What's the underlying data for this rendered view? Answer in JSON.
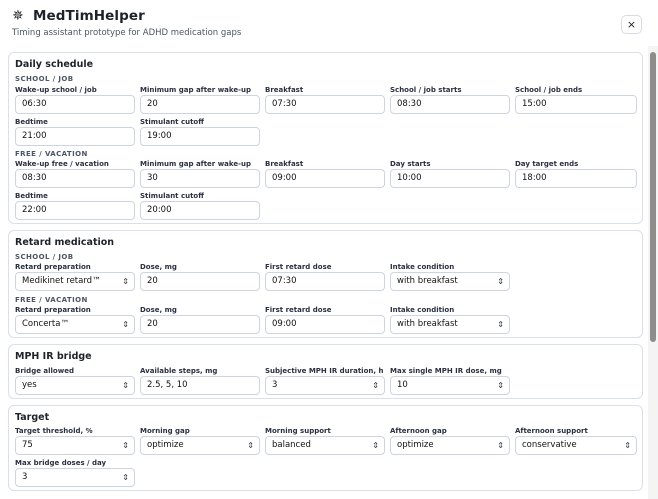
{
  "app": {
    "title": "MedTimHelper",
    "subtitle": "Timing assistant prototype for ADHD medication gaps",
    "close": "×"
  },
  "daily": {
    "title": "Daily schedule",
    "school": {
      "group": "SCHOOL / JOB",
      "wakeup_label": "Wake-up school / job",
      "wakeup": "06:30",
      "mingap_label": "Minimum gap after wake-up",
      "mingap": "20",
      "breakfast_label": "Breakfast",
      "breakfast": "07:30",
      "starts_label": "School / job starts",
      "starts": "08:30",
      "ends_label": "School / job ends",
      "ends": "15:00",
      "bedtime_label": "Bedtime",
      "bedtime": "21:00",
      "cutoff_label": "Stimulant cutoff",
      "cutoff": "19:00"
    },
    "free": {
      "group": "FREE / VACATION",
      "wakeup_label": "Wake-up free / vacation",
      "wakeup": "08:30",
      "mingap_label": "Minimum gap after wake-up",
      "mingap": "30",
      "breakfast_label": "Breakfast",
      "breakfast": "09:00",
      "starts_label": "Day starts",
      "starts": "10:00",
      "ends_label": "Day target ends",
      "ends": "18:00",
      "bedtime_label": "Bedtime",
      "bedtime": "22:00",
      "cutoff_label": "Stimulant cutoff",
      "cutoff": "20:00"
    }
  },
  "retard": {
    "title": "Retard medication",
    "school": {
      "group": "SCHOOL / JOB",
      "prep_label": "Retard preparation",
      "prep": "Medikinet retard™",
      "dose_label": "Dose, mg",
      "dose": "20",
      "first_label": "First retard dose",
      "first": "07:30",
      "cond_label": "Intake condition",
      "cond": "with breakfast"
    },
    "free": {
      "group": "FREE / VACATION",
      "prep_label": "Retard preparation",
      "prep": "Concerta™",
      "dose_label": "Dose, mg",
      "dose": "20",
      "first_label": "First retard dose",
      "first": "09:00",
      "cond_label": "Intake condition",
      "cond": "with breakfast"
    }
  },
  "bridge": {
    "title": "MPH IR bridge",
    "allowed_label": "Bridge allowed",
    "allowed": "yes",
    "steps_label": "Available steps, mg",
    "steps": "2.5, 5, 10",
    "duration_label": "Subjective MPH IR duration, h",
    "duration": "3",
    "max_label": "Max single MPH IR dose, mg",
    "max": "10"
  },
  "target": {
    "title": "Target",
    "threshold_label": "Target threshold, %",
    "threshold": "75",
    "mgap_label": "Morning gap",
    "mgap": "optimize",
    "msupport_label": "Morning support",
    "msupport": "balanced",
    "agap_label": "Afternoon gap",
    "agap": "optimize",
    "asupport_label": "Afternoon support",
    "asupport": "conservative",
    "maxbridge_label": "Max bridge doses / day",
    "maxbridge": "3"
  },
  "icons": {
    "logo": "star-icon",
    "chevron": "chevron-updown-icon",
    "close": "close-icon"
  }
}
